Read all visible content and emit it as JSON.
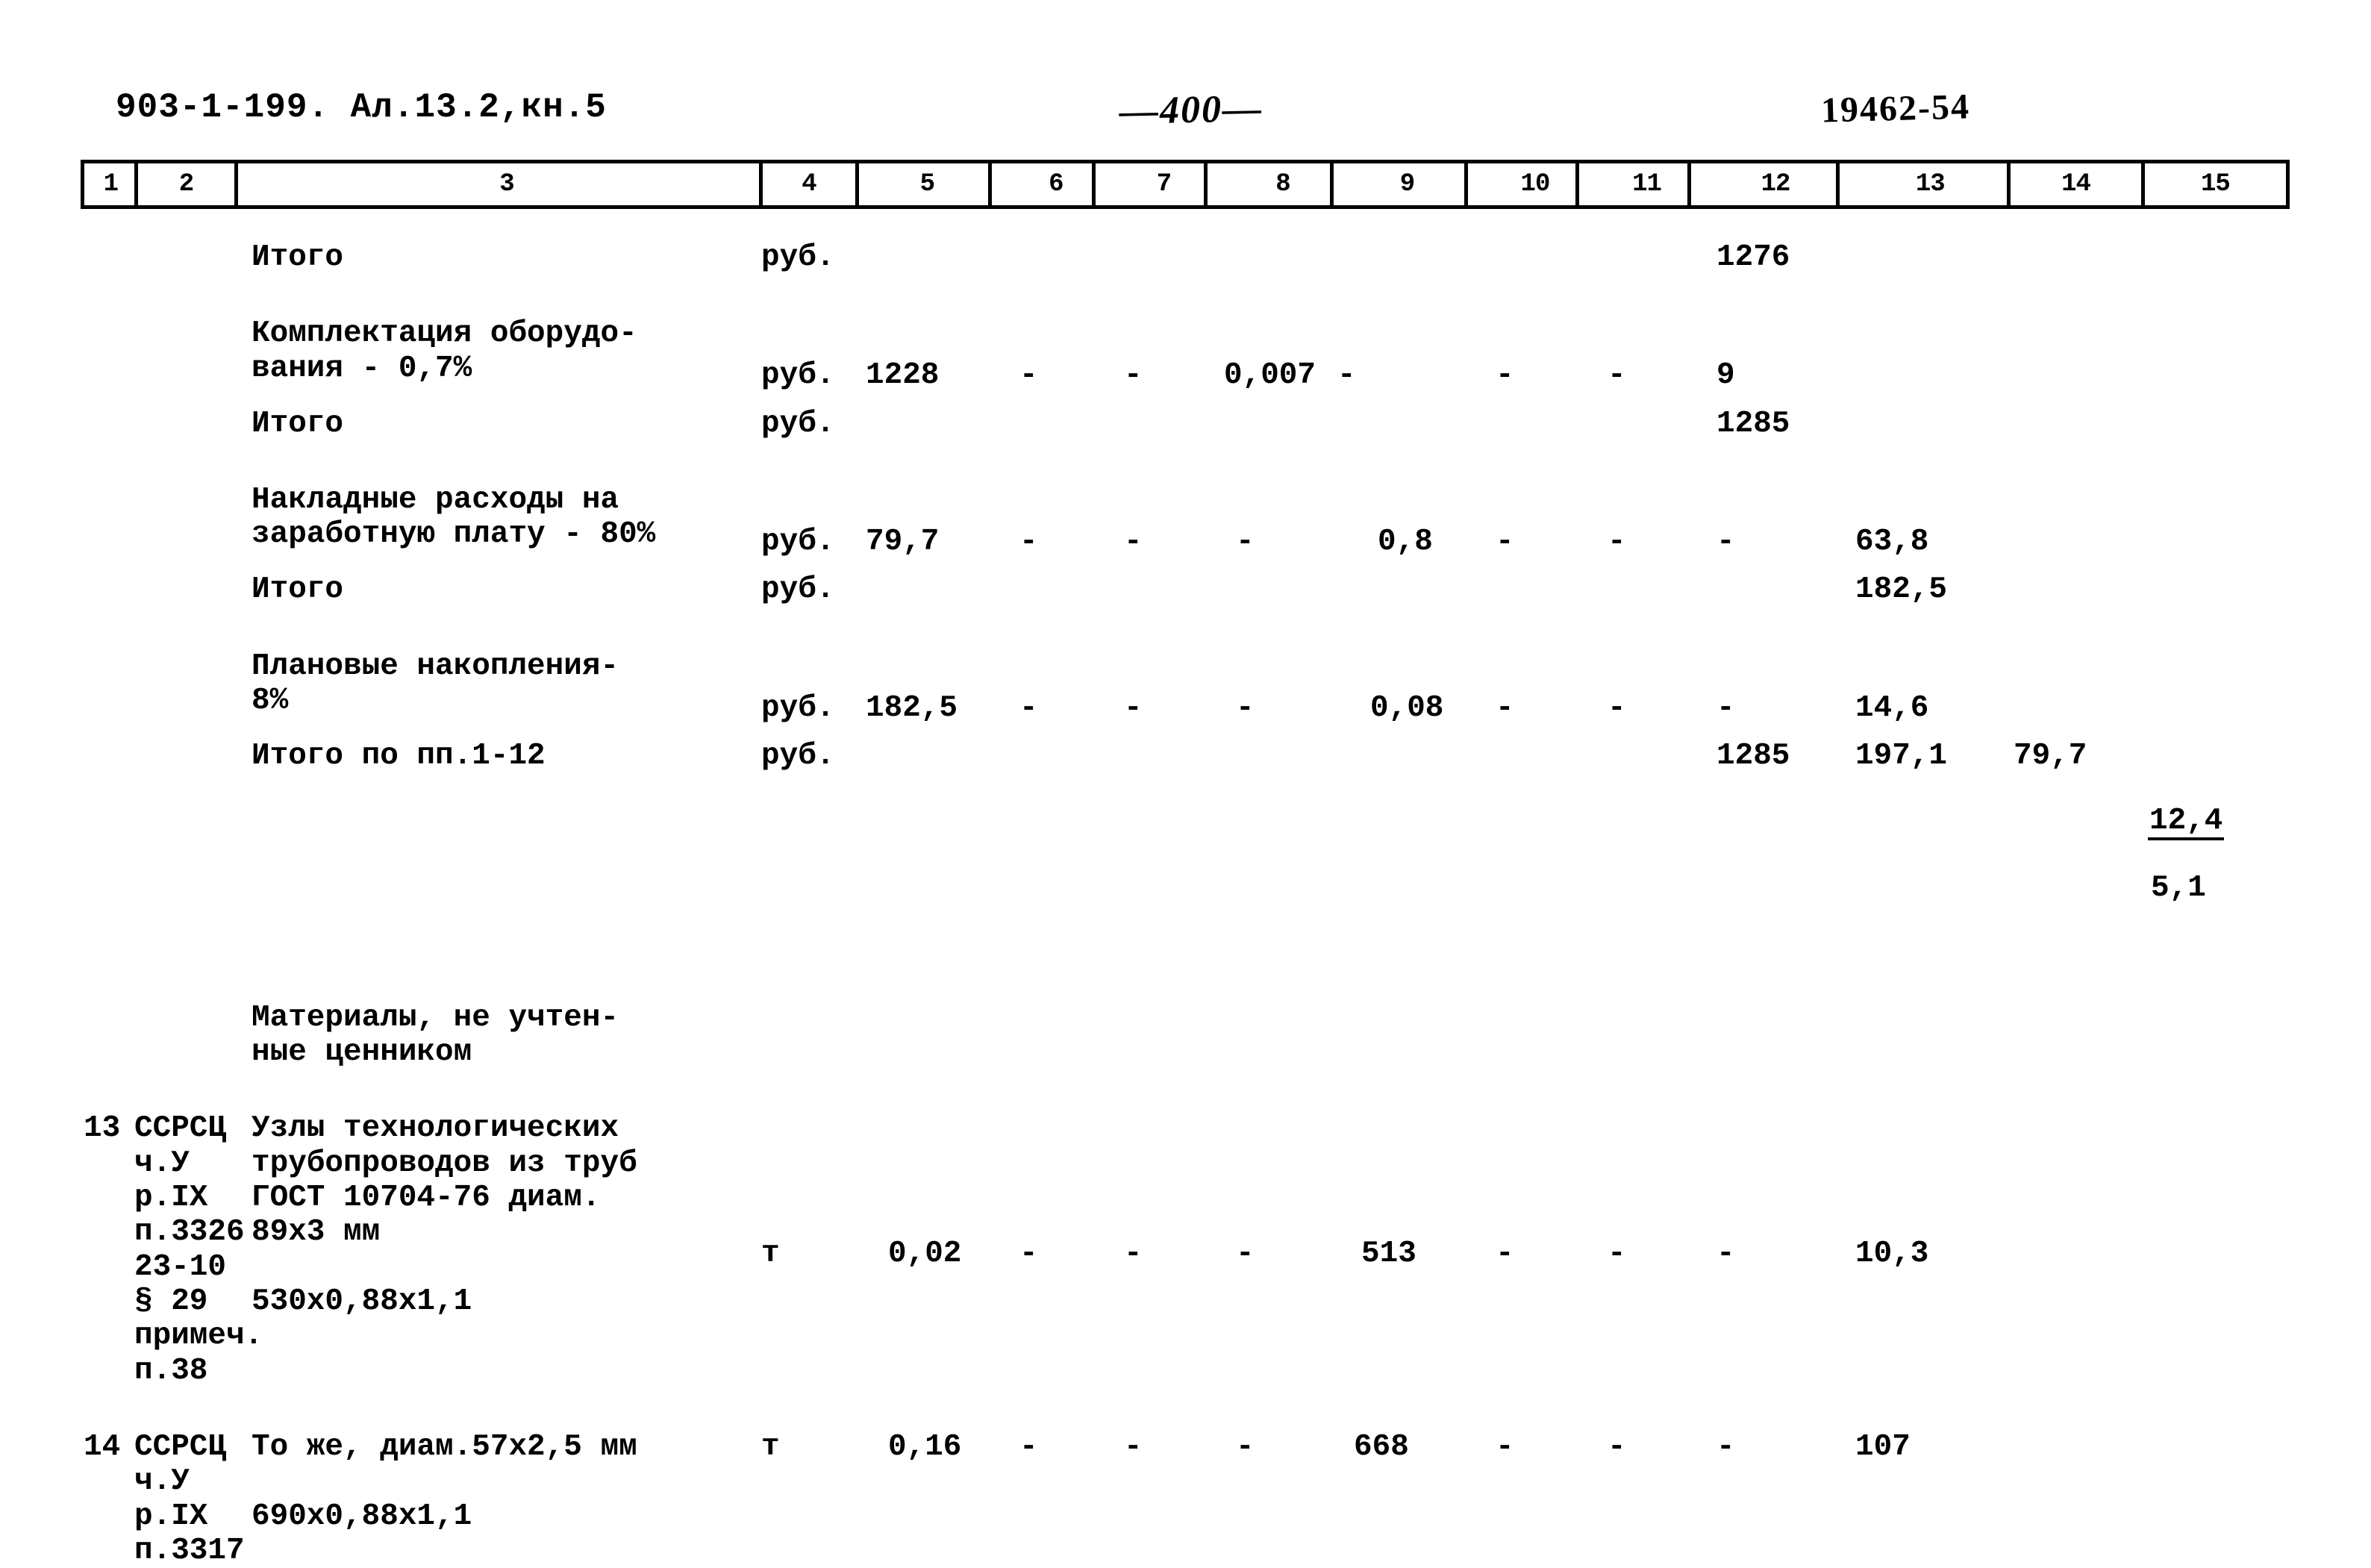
{
  "header": {
    "left": "903-1-199. Ал.13.2,кн.5",
    "page_number": "—400—",
    "stamp": "19462-54"
  },
  "table": {
    "column_numbers": [
      "1",
      "2",
      "3",
      "4",
      "5",
      "6",
      "7",
      "8",
      "9",
      "10",
      "11",
      "12",
      "13",
      "14",
      "15"
    ],
    "rows": [
      {
        "id": "row-itogo-1",
        "c1": "",
        "c2": "",
        "c3": "Итого",
        "c4": "руб.",
        "c5": "",
        "c6": "",
        "c7": "",
        "c8": "",
        "c9": "",
        "c10": "",
        "c11": "",
        "c12": "1276",
        "c13": "",
        "c14": "",
        "c15": ""
      },
      {
        "id": "row-komplektaciya",
        "c1": "",
        "c2": "",
        "c3": "Комплектация оборудо-\nвания - 0,7%",
        "c4": "руб.",
        "c5": "1228",
        "c6": "-",
        "c7": "-",
        "c8": "0,007",
        "c9": "-",
        "c10": "-",
        "c11": "-",
        "c12": "9",
        "c13": "",
        "c14": "",
        "c15": ""
      },
      {
        "id": "row-itogo-2",
        "c1": "",
        "c2": "",
        "c3": "Итого",
        "c4": "руб.",
        "c5": "",
        "c6": "",
        "c7": "",
        "c8": "",
        "c9": "",
        "c10": "",
        "c11": "",
        "c12": "1285",
        "c13": "",
        "c14": "",
        "c15": ""
      },
      {
        "id": "row-nakladnye",
        "c1": "",
        "c2": "",
        "c3": "Накладные расходы на\nзаработную плату - 80%",
        "c4": "руб.",
        "c5": "79,7",
        "c6": "-",
        "c7": "-",
        "c8": "-",
        "c9": "0,8",
        "c10": "-",
        "c11": "-",
        "c12": "-",
        "c13": "63,8",
        "c14": "",
        "c15": ""
      },
      {
        "id": "row-itogo-3",
        "c1": "",
        "c2": "",
        "c3": "Итого",
        "c4": "руб.",
        "c5": "",
        "c6": "",
        "c7": "",
        "c8": "",
        "c9": "",
        "c10": "",
        "c11": "",
        "c12": "",
        "c13": "182,5",
        "c14": "",
        "c15": ""
      },
      {
        "id": "row-planovye",
        "c1": "",
        "c2": "",
        "c3": "Плановые накопления-\n8%",
        "c4": "руб.",
        "c5": "182,5",
        "c6": "-",
        "c7": "-",
        "c8": "-",
        "c9": "0,08",
        "c10": "-",
        "c11": "-",
        "c12": "-",
        "c13": "14,6",
        "c14": "",
        "c15": ""
      },
      {
        "id": "row-itogo-pp",
        "c1": "",
        "c2": "",
        "c3": "Итого по пп.1-12",
        "c4": "руб.",
        "c5": "",
        "c6": "",
        "c7": "",
        "c8": "",
        "c9": "",
        "c10": "",
        "c11": "",
        "c12": "1285",
        "c13": "197,1",
        "c14": "79,7",
        "c15_fraction": {
          "numerator": "12,4",
          "denominator": "5,1"
        }
      },
      {
        "id": "row-materialy-heading",
        "c1": "",
        "c2": "",
        "c3": "Материалы, не учтен-\n    ные ценником",
        "c4": "",
        "c5": "",
        "c6": "",
        "c7": "",
        "c8": "",
        "c9": "",
        "c10": "",
        "c11": "",
        "c12": "",
        "c13": "",
        "c14": "",
        "c15": ""
      },
      {
        "id": "row-item-13",
        "c1": "13",
        "c2": "ССРСЦ\n  ч.У\n  р.IX\n  п.3326\n 23-10\n § 29\nпримеч.\n  п.38",
        "c3": "Узлы технологических\nтрубопроводов из труб\nГОСТ 10704-76 диам.\n89х3 мм\n\n530х0,88х1,1",
        "c4": "т",
        "c5": "0,02",
        "c6": "-",
        "c7": "-",
        "c8": "-",
        "c9": "513",
        "c10": "-",
        "c11": "-",
        "c12": "-",
        "c13": "10,3",
        "c14": "",
        "c15": ""
      },
      {
        "id": "row-item-14",
        "c1": "14",
        "c2": "ССРСЦ\n  ч.У\n  р.IX\n  п.3317",
        "c3": "То же, диам.57х2,5 мм\n\n690х0,88х1,1",
        "c4": "т",
        "c5": "0,16",
        "c6": "-",
        "c7": "-",
        "c8": "-",
        "c9": "668",
        "c10": "-",
        "c11": "-",
        "c12": "-",
        "c13": "107",
        "c14": "",
        "c15": ""
      }
    ]
  }
}
